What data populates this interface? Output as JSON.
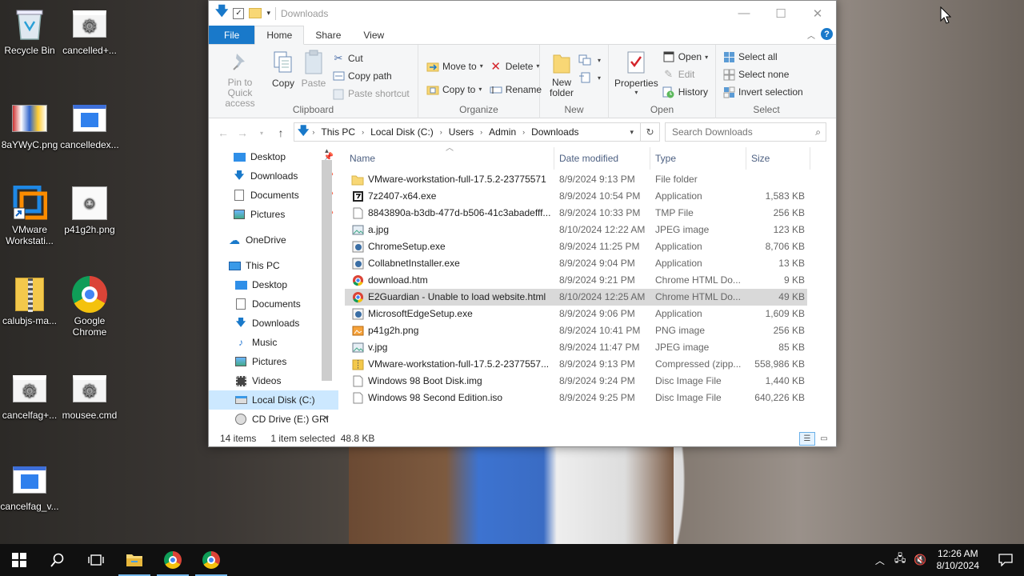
{
  "desktop": {
    "icons": [
      {
        "label": "Recycle Bin"
      },
      {
        "label": "cancelled+..."
      },
      {
        "label": "8aYWyC.png"
      },
      {
        "label": "cancelledex..."
      },
      {
        "label": "VMware Workstati..."
      },
      {
        "label": "p41g2h.png"
      },
      {
        "label": "calubjs-ma..."
      },
      {
        "label": "Google Chrome"
      },
      {
        "label": "cancelfag+..."
      },
      {
        "label": "mousee.cmd"
      },
      {
        "label": "cancelfag_v..."
      }
    ]
  },
  "window": {
    "title": "Downloads",
    "controls": {
      "minimize": "—",
      "maximize": "☐",
      "close": "✕"
    }
  },
  "ribbon": {
    "tabs": {
      "file": "File",
      "home": "Home",
      "share": "Share",
      "view": "View"
    },
    "clipboard": {
      "label": "Clipboard",
      "pin": "Pin to Quick access",
      "copy": "Copy",
      "paste": "Paste",
      "cut": "Cut",
      "copy_path": "Copy path",
      "paste_shortcut": "Paste shortcut"
    },
    "organize": {
      "label": "Organize",
      "move_to": "Move to",
      "copy_to": "Copy to",
      "delete": "Delete",
      "rename": "Rename"
    },
    "new": {
      "label": "New",
      "new_folder": "New folder"
    },
    "open": {
      "label": "Open",
      "properties": "Properties",
      "open": "Open",
      "edit": "Edit",
      "history": "History"
    },
    "select": {
      "label": "Select",
      "select_all": "Select all",
      "select_none": "Select none",
      "invert": "Invert selection"
    }
  },
  "address": {
    "crumbs": [
      "This PC",
      "Local Disk (C:)",
      "Users",
      "Admin",
      "Downloads"
    ],
    "search_placeholder": "Search Downloads"
  },
  "navpane": {
    "items": [
      {
        "label": "Desktop"
      },
      {
        "label": "Downloads"
      },
      {
        "label": "Documents"
      },
      {
        "label": "Pictures"
      },
      {
        "label": "OneDrive"
      },
      {
        "label": "This PC"
      },
      {
        "label": "Desktop"
      },
      {
        "label": "Documents"
      },
      {
        "label": "Downloads"
      },
      {
        "label": "Music"
      },
      {
        "label": "Pictures"
      },
      {
        "label": "Videos"
      },
      {
        "label": "Local Disk (C:)"
      },
      {
        "label": "CD Drive (E:) GRI"
      }
    ]
  },
  "columns": {
    "name": "Name",
    "date": "Date modified",
    "type": "Type",
    "size": "Size"
  },
  "files": [
    {
      "name": "VMware-workstation-full-17.5.2-23775571",
      "date": "8/9/2024 9:13 PM",
      "type": "File folder",
      "size": "",
      "icon": "folder-icon"
    },
    {
      "name": "7z2407-x64.exe",
      "date": "8/9/2024 10:54 PM",
      "type": "Application",
      "size": "1,583 KB",
      "icon": "7zip-icon"
    },
    {
      "name": "8843890a-b3db-477d-b506-41c3abadefff....",
      "date": "8/9/2024 10:33 PM",
      "type": "TMP File",
      "size": "256 KB",
      "icon": "file-icon"
    },
    {
      "name": "a.jpg",
      "date": "8/10/2024 12:22 AM",
      "type": "JPEG image",
      "size": "123 KB",
      "icon": "image-icon"
    },
    {
      "name": "ChromeSetup.exe",
      "date": "8/9/2024 11:25 PM",
      "type": "Application",
      "size": "8,706 KB",
      "icon": "installer-icon"
    },
    {
      "name": "CollabnetInstaller.exe",
      "date": "8/9/2024 9:04 PM",
      "type": "Application",
      "size": "13 KB",
      "icon": "installer-icon"
    },
    {
      "name": "download.htm",
      "date": "8/9/2024 9:21 PM",
      "type": "Chrome HTML Do...",
      "size": "9 KB",
      "icon": "chrome-icon"
    },
    {
      "name": "E2Guardian - Unable to load website.html",
      "date": "8/10/2024 12:25 AM",
      "type": "Chrome HTML Do...",
      "size": "49 KB",
      "icon": "chrome-icon"
    },
    {
      "name": "MicrosoftEdgeSetup.exe",
      "date": "8/9/2024 9:06 PM",
      "type": "Application",
      "size": "1,609 KB",
      "icon": "installer-icon"
    },
    {
      "name": "p41g2h.png",
      "date": "8/9/2024 10:41 PM",
      "type": "PNG image",
      "size": "256 KB",
      "icon": "png-icon"
    },
    {
      "name": "v.jpg",
      "date": "8/9/2024 11:47 PM",
      "type": "JPEG image",
      "size": "85 KB",
      "icon": "image-icon"
    },
    {
      "name": "VMware-workstation-full-17.5.2-2377557...",
      "date": "8/9/2024 9:13 PM",
      "type": "Compressed (zipp...",
      "size": "558,986 KB",
      "icon": "zip-icon"
    },
    {
      "name": "Windows 98 Boot Disk.img",
      "date": "8/9/2024 9:24 PM",
      "type": "Disc Image File",
      "size": "1,440 KB",
      "icon": "file-icon"
    },
    {
      "name": "Windows 98 Second Edition.iso",
      "date": "8/9/2024 9:25 PM",
      "type": "Disc Image File",
      "size": "640,226 KB",
      "icon": "file-icon"
    }
  ],
  "status": {
    "count": "14 items",
    "selected": "1 item selected  48.8 KB"
  },
  "taskbar": {
    "time": "12:26 AM",
    "date": "8/10/2024"
  },
  "colors": {
    "accent": "#1979ca",
    "selection": "#cce8ff",
    "taskbar": "#101010"
  }
}
